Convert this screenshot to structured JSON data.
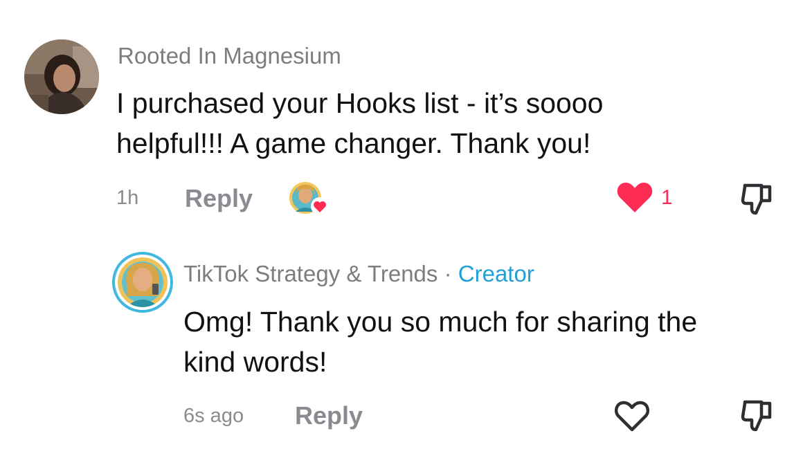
{
  "comments": [
    {
      "username": "Rooted In Magnesium",
      "text_line1": "I purchased your Hooks list - it’s soooo",
      "text_line2": "helpful!!! A game changer. Thank you!",
      "time": "1h",
      "reply_label": "Reply",
      "like_count": "1",
      "liked": true,
      "creator_liked": true
    },
    {
      "username": "TikTok Strategy & Trends",
      "separator": "·",
      "badge": "Creator",
      "text_line1": "Omg! Thank you so much for sharing the",
      "text_line2": "kind words!",
      "time": "6s ago",
      "reply_label": "Reply",
      "liked": false
    }
  ],
  "colors": {
    "like_active": "#fe2c55",
    "creator_badge": "#20a0d4",
    "muted": "#8a8b91",
    "avatar_ring": "#3fb7e2"
  },
  "icons": {
    "like": "heart-icon",
    "dislike": "thumbs-down-icon",
    "creator_liked": "creator-avatar-heart-icon"
  }
}
